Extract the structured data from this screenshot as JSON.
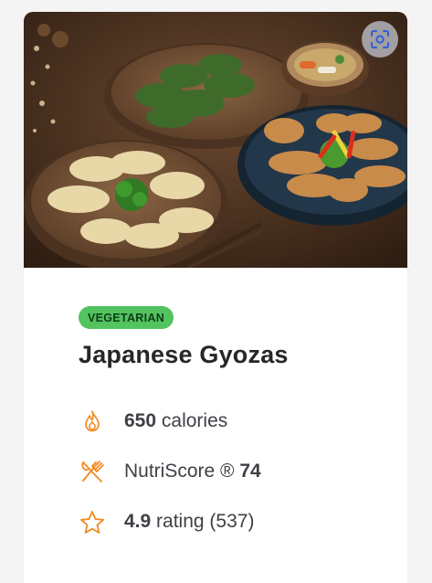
{
  "card": {
    "badge": "VEGETARIAN",
    "title": "Japanese Gyozas",
    "image_alt": "Plates of Japanese gyozas",
    "stats": {
      "calories": {
        "value": "650",
        "unit": "calories",
        "icon": "flame-icon"
      },
      "nutriscore": {
        "label": "NutriScore ®",
        "value": "74",
        "icon": "fork-knife-icon"
      },
      "rating": {
        "value": "4.9",
        "label": "rating (537)",
        "icon": "star-icon"
      }
    }
  },
  "colors": {
    "accent": "#f08a24",
    "badge_bg": "#52c35f",
    "title": "#27272a"
  }
}
